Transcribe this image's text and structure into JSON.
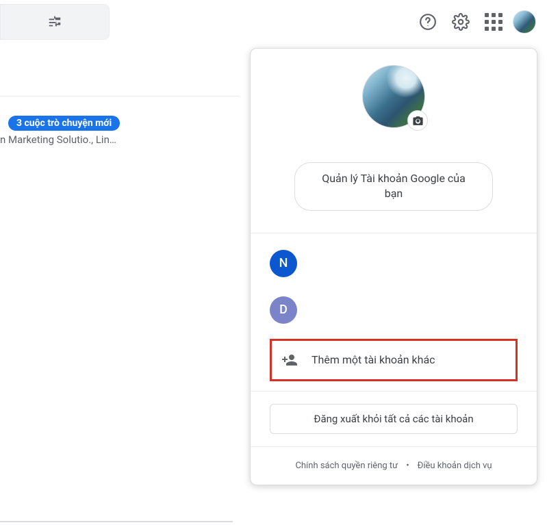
{
  "topbar": {
    "filter_icon": "tune-icon",
    "help_icon": "help-icon",
    "settings_icon": "gear-icon",
    "apps_icon": "apps-grid-icon"
  },
  "inbox": {
    "chip": "3 cuộc trò chuyện mới",
    "preview": "n Marketing Solutio., Lin…"
  },
  "popup": {
    "manage_label": "Quản lý Tài khoản Google của bạn",
    "accounts": [
      {
        "initial": "N",
        "color_class": "acct-n"
      },
      {
        "initial": "D",
        "color_class": "acct-d"
      }
    ],
    "add_label": "Thêm một tài khoản khác",
    "signout_label": "Đăng xuất khỏi tất cả các tài khoản",
    "privacy": "Chính sách quyền riêng tư",
    "terms": "Điều khoản dịch vụ"
  }
}
